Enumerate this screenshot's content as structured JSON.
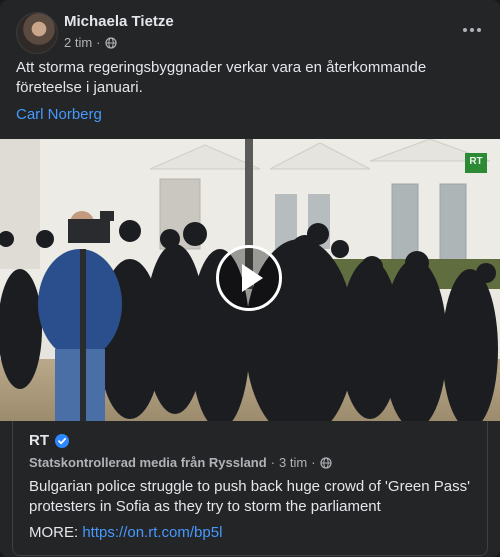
{
  "post": {
    "author": "Michaela Tietze",
    "time": "2 tim",
    "separator": "·",
    "text": "Att storma regeringsbyggnader verkar vara en återkommande företeelse i januari.",
    "tagged": "Carl Norberg"
  },
  "video": {
    "logo": "RT"
  },
  "shared": {
    "source": "RT",
    "label": "Statskontrollerad media från Ryssland",
    "time": "3 tim",
    "separator": "·",
    "text": "Bulgarian police struggle to push back huge crowd of 'Green Pass' protesters in Sofia as they try to storm the parliament",
    "more_label": "MORE: ",
    "more_link": "https://on.rt.com/bp5l"
  },
  "colors": {
    "link": "#4599ff",
    "verified": "#2d88ff",
    "rt_green": "#2c8a35"
  },
  "icons": [
    "globe-icon",
    "verified-badge-icon",
    "more-options-icon",
    "play-icon"
  ]
}
